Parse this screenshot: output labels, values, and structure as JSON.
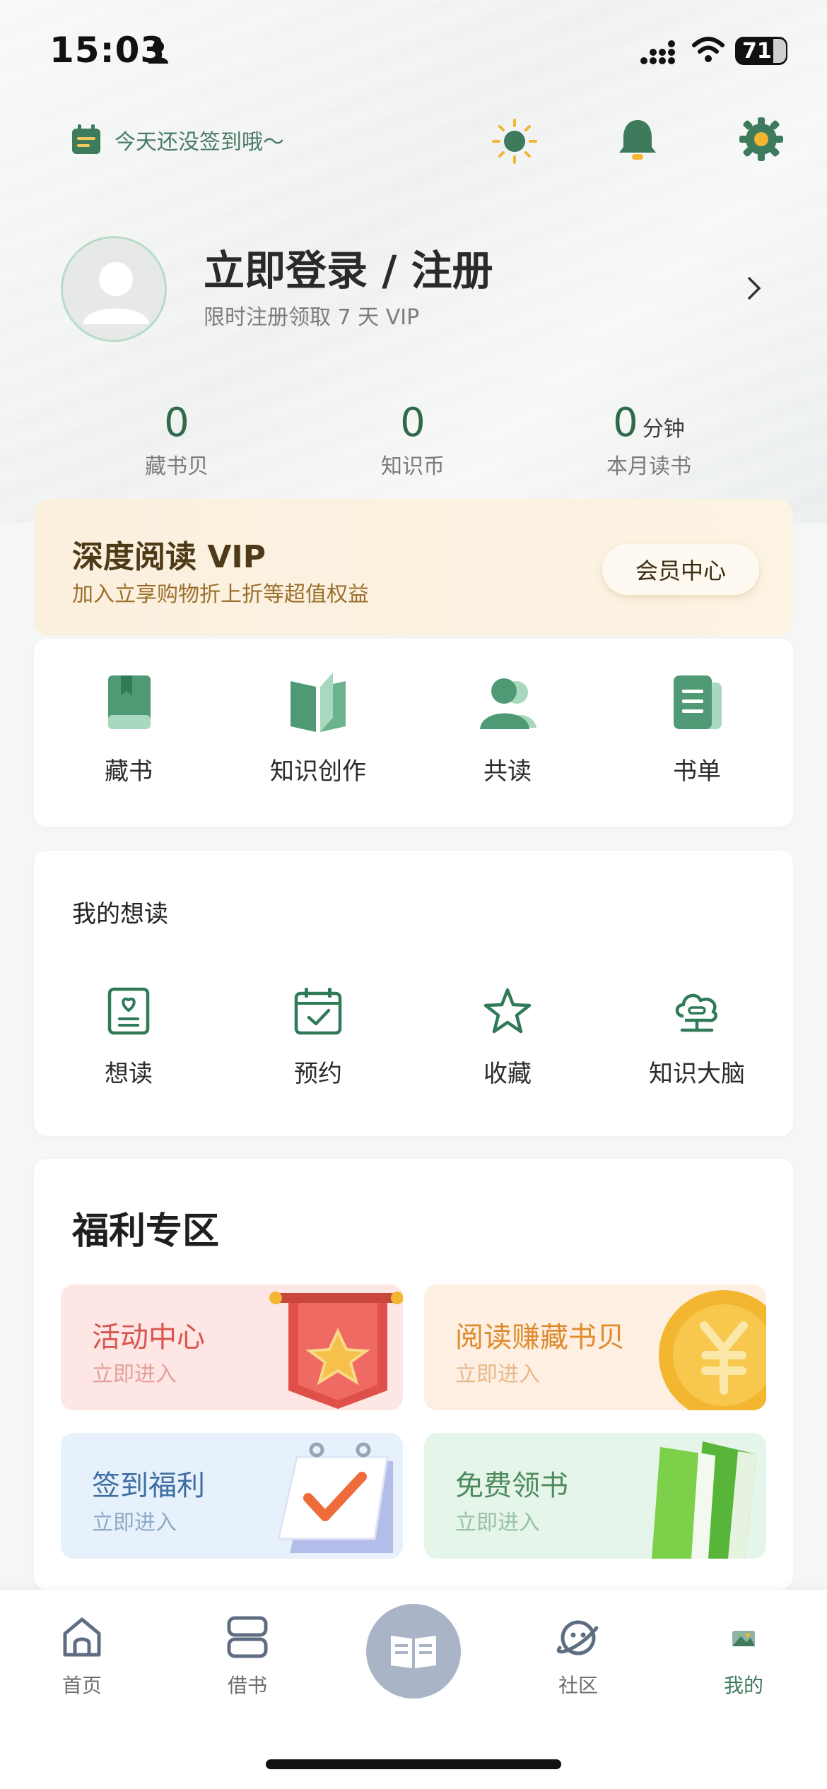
{
  "status_bar": {
    "time": "15:03",
    "battery": "71"
  },
  "header": {
    "checkin_text": "今天还没签到哦～"
  },
  "profile": {
    "title": "立即登录 / 注册",
    "subtitle": "限时注册领取 7 天 VIP"
  },
  "stats": [
    {
      "value": "0",
      "unit": "",
      "label": "藏书贝"
    },
    {
      "value": "0",
      "unit": "",
      "label": "知识币"
    },
    {
      "value": "0",
      "unit": "分钟",
      "label": "本月读书"
    }
  ],
  "vip": {
    "title": "深度阅读 VIP",
    "subtitle": "加入立享购物折上折等超值权益",
    "button": "会员中心"
  },
  "actions": [
    {
      "label": "藏书",
      "icon": "bookmark-book-icon"
    },
    {
      "label": "知识创作",
      "icon": "open-book-icon"
    },
    {
      "label": "共读",
      "icon": "group-users-icon"
    },
    {
      "label": "书单",
      "icon": "booklist-icon"
    }
  ],
  "wishlist": {
    "title": "我的想读",
    "items": [
      {
        "label": "想读",
        "icon": "heart-note-icon"
      },
      {
        "label": "预约",
        "icon": "calendar-check-icon"
      },
      {
        "label": "收藏",
        "icon": "star-icon"
      },
      {
        "label": "知识大脑",
        "icon": "brain-cloud-icon"
      }
    ]
  },
  "benefits": {
    "title": "福利专区",
    "tiles": [
      {
        "title": "活动中心",
        "sub": "立即进入",
        "title_color": "#d9554f",
        "sub_color": "#e2a09b",
        "bg": "#fde6e4"
      },
      {
        "title": "阅读赚藏书贝",
        "sub": "立即进入",
        "title_color": "#e08a2e",
        "sub_color": "#e8b98a",
        "bg": "#fdf0e2"
      },
      {
        "title": "签到福利",
        "sub": "立即进入",
        "title_color": "#3f6ea3",
        "sub_color": "#8fa9c6",
        "bg": "#e7f1fb"
      },
      {
        "title": "免费领书",
        "sub": "立即进入",
        "title_color": "#4d8a5e",
        "sub_color": "#98c2a4",
        "bg": "#e6f5ea"
      }
    ]
  },
  "nav": [
    {
      "label": "首页",
      "icon": "home-icon"
    },
    {
      "label": "借书",
      "icon": "borrow-icon"
    },
    {
      "label": "",
      "icon": "reader-book-icon"
    },
    {
      "label": "社区",
      "icon": "planet-icon"
    },
    {
      "label": "我的",
      "icon": "profile-icon",
      "active": true
    }
  ],
  "colors": {
    "accent": "#2f7a57",
    "accent_light": "#8bc8a6",
    "vip_bg": "#fbf0de"
  }
}
